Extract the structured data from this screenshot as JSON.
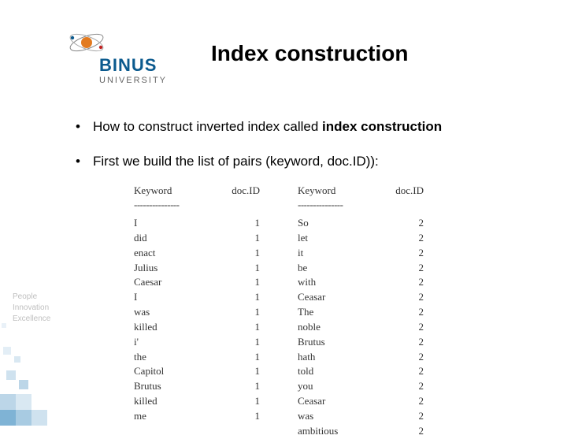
{
  "logo": {
    "brand": "BINUS",
    "sub": "UNIVERSITY"
  },
  "title": "Index construction",
  "bullets": [
    {
      "prefix": "How to construct inverted index called ",
      "bold": "index construction"
    },
    {
      "prefix": "First we build the list of pairs (keyword, doc.ID)):",
      "bold": ""
    }
  ],
  "tagline": [
    "People",
    "Innovation",
    "Excellence"
  ],
  "table": {
    "headers": {
      "keyword": "Keyword",
      "docid": "doc.ID"
    },
    "dashes": "---------------",
    "left": [
      {
        "k": "I",
        "d": "1"
      },
      {
        "k": "did",
        "d": "1"
      },
      {
        "k": "enact",
        "d": "1"
      },
      {
        "k": "Julius",
        "d": "1"
      },
      {
        "k": "Caesar",
        "d": "1"
      },
      {
        "k": "I",
        "d": "1"
      },
      {
        "k": "was",
        "d": "1"
      },
      {
        "k": "killed",
        "d": "1"
      },
      {
        "k": "i'",
        "d": "1"
      },
      {
        "k": "the",
        "d": "1"
      },
      {
        "k": "Capitol",
        "d": "1"
      },
      {
        "k": "Brutus",
        "d": "1"
      },
      {
        "k": "killed",
        "d": "1"
      },
      {
        "k": "me",
        "d": "1"
      }
    ],
    "right": [
      {
        "k": "So",
        "d": "2"
      },
      {
        "k": "let",
        "d": "2"
      },
      {
        "k": "it",
        "d": "2"
      },
      {
        "k": "be",
        "d": "2"
      },
      {
        "k": "with",
        "d": "2"
      },
      {
        "k": "Ceasar",
        "d": "2"
      },
      {
        "k": "The",
        "d": "2"
      },
      {
        "k": "noble",
        "d": "2"
      },
      {
        "k": "Brutus",
        "d": "2"
      },
      {
        "k": "hath",
        "d": "2"
      },
      {
        "k": "told",
        "d": "2"
      },
      {
        "k": "you",
        "d": "2"
      },
      {
        "k": "Ceasar",
        "d": "2"
      },
      {
        "k": "was",
        "d": "2"
      },
      {
        "k": "ambitious",
        "d": "2"
      }
    ]
  }
}
